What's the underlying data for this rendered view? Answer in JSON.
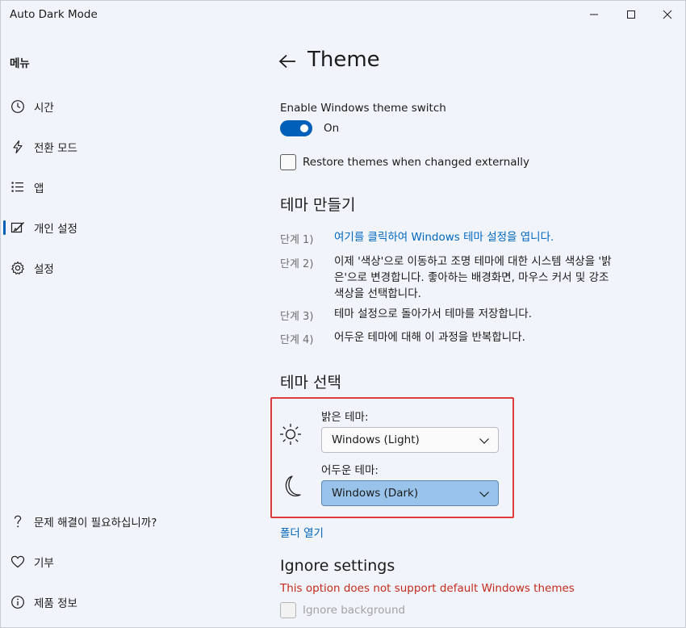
{
  "window": {
    "title": "Auto Dark Mode"
  },
  "sidebar": {
    "header": "메뉴",
    "items": [
      {
        "label": "시간",
        "icon": "clock-icon"
      },
      {
        "label": "전환 모드",
        "icon": "lightning-icon"
      },
      {
        "label": "앱",
        "icon": "list-icon"
      },
      {
        "label": "개인 설정",
        "icon": "personalize-icon",
        "selected": true
      },
      {
        "label": "설정",
        "icon": "gear-icon"
      }
    ],
    "footer": [
      {
        "label": "문제 해결이 필요하십니까?",
        "icon": "question-icon"
      },
      {
        "label": "기부",
        "icon": "heart-icon"
      },
      {
        "label": "제품 정보",
        "icon": "info-icon"
      }
    ]
  },
  "page": {
    "title": "Theme",
    "enable_label": "Enable Windows theme switch",
    "toggle_state": "On",
    "restore_label": "Restore themes when changed externally",
    "create_title": "테마 만들기",
    "steps": [
      {
        "label": "단계 1)",
        "text": "여기를 클릭하여 Windows 테마 설정을 엽니다."
      },
      {
        "label": "단계 2)",
        "text": "이제 '색상'으로 이동하고 조명 테마에 대한 시스템 색상을 '밝은'으로 변경합니다. 좋아하는 배경화면, 마우스 커서 및 강조 색상을 선택합니다."
      },
      {
        "label": "단계 3)",
        "text": "테마 설정으로 돌아가서 테마를 저장합니다."
      },
      {
        "label": "단계 4)",
        "text": "어두운 테마에 대해 이 과정을 반복합니다."
      }
    ],
    "select_title": "테마 선택",
    "light_label": "밝은 테마:",
    "light_value": "Windows (Light)",
    "dark_label": "어두운 테마:",
    "dark_value": "Windows (Dark)",
    "folder_link": "폴더 열기",
    "ignore_title": "Ignore settings",
    "ignore_warning": "This option does not support default Windows themes",
    "ignore_background": "Ignore background"
  },
  "colors": {
    "accent": "#005fb8",
    "link": "#0067c0",
    "warning": "#c42b1c",
    "highlight": "#e03b3b"
  }
}
